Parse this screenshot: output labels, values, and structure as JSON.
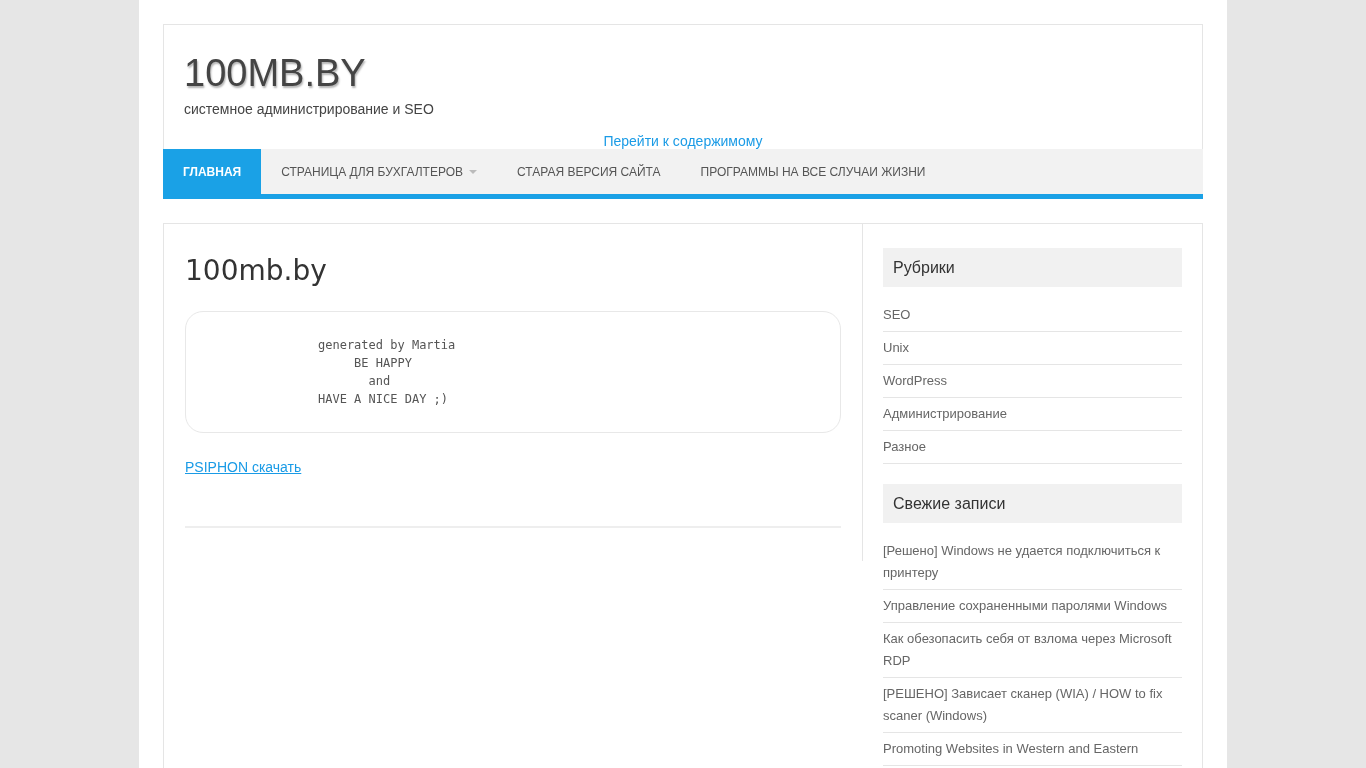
{
  "site": {
    "title": "100MB.BY",
    "tagline": "системное администрирование и SEO",
    "skip_link": "Перейти к содержимому"
  },
  "nav": [
    {
      "label": "ГЛАВНАЯ",
      "selected": true,
      "has_submenu": false
    },
    {
      "label": "СТРАНИЦА ДЛЯ БУХГАЛТЕРОВ",
      "selected": false,
      "has_submenu": true
    },
    {
      "label": "СТАРАЯ ВЕРСИЯ САЙТА",
      "selected": false,
      "has_submenu": false
    },
    {
      "label": "ПРОГРАММЫ НА ВСЕ СЛУЧАИ ЖИЗНИ",
      "selected": false,
      "has_submenu": false
    }
  ],
  "post": {
    "title": "100mb.by",
    "code": "generated by Martia\n     BE HAPPY\n       and\nHAVE A NICE DAY ;)",
    "link": "PSIPHON скачать"
  },
  "sidebar": [
    {
      "title": "Рубрики",
      "items": [
        "SEO",
        "Unix",
        "WordPress",
        "Администрирование",
        "Разное"
      ]
    },
    {
      "title": "Свежие записи",
      "items": [
        "[Решено] Windows не удается подключиться к принтеру",
        "Управление сохраненными паролями Windows",
        "Как обезопасить себя от взлома через Microsoft RDP",
        "[РЕШЕНО] Зависает сканер (WIA) / HOW to fix scaner (Windows)",
        "Promoting Websites in Western and Eastern"
      ]
    }
  ]
}
